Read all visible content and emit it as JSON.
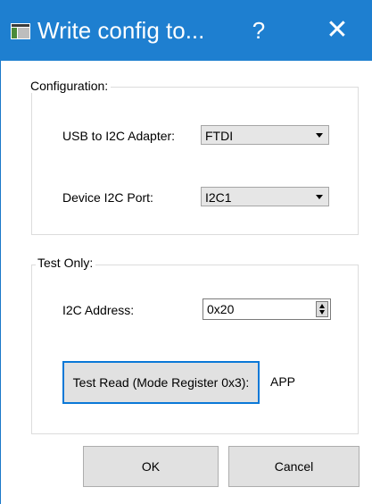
{
  "window": {
    "title": "Write config to...",
    "help_glyph": "?",
    "close_glyph": "✕",
    "accent": "#1e7fd0",
    "icon": "app-window-icon"
  },
  "configuration": {
    "group_label": "Configuration:",
    "adapter_label": "USB to I2C Adapter:",
    "adapter_value": "FTDI",
    "port_label": "Device I2C Port:",
    "port_value": "I2C1"
  },
  "test_only": {
    "group_label": "Test Only:",
    "address_label": "I2C Address:",
    "address_value": "0x20",
    "test_read_button": "Test Read (Mode Register 0x3):",
    "test_read_result": "APP"
  },
  "footer": {
    "ok_label": "OK",
    "cancel_label": "Cancel"
  }
}
